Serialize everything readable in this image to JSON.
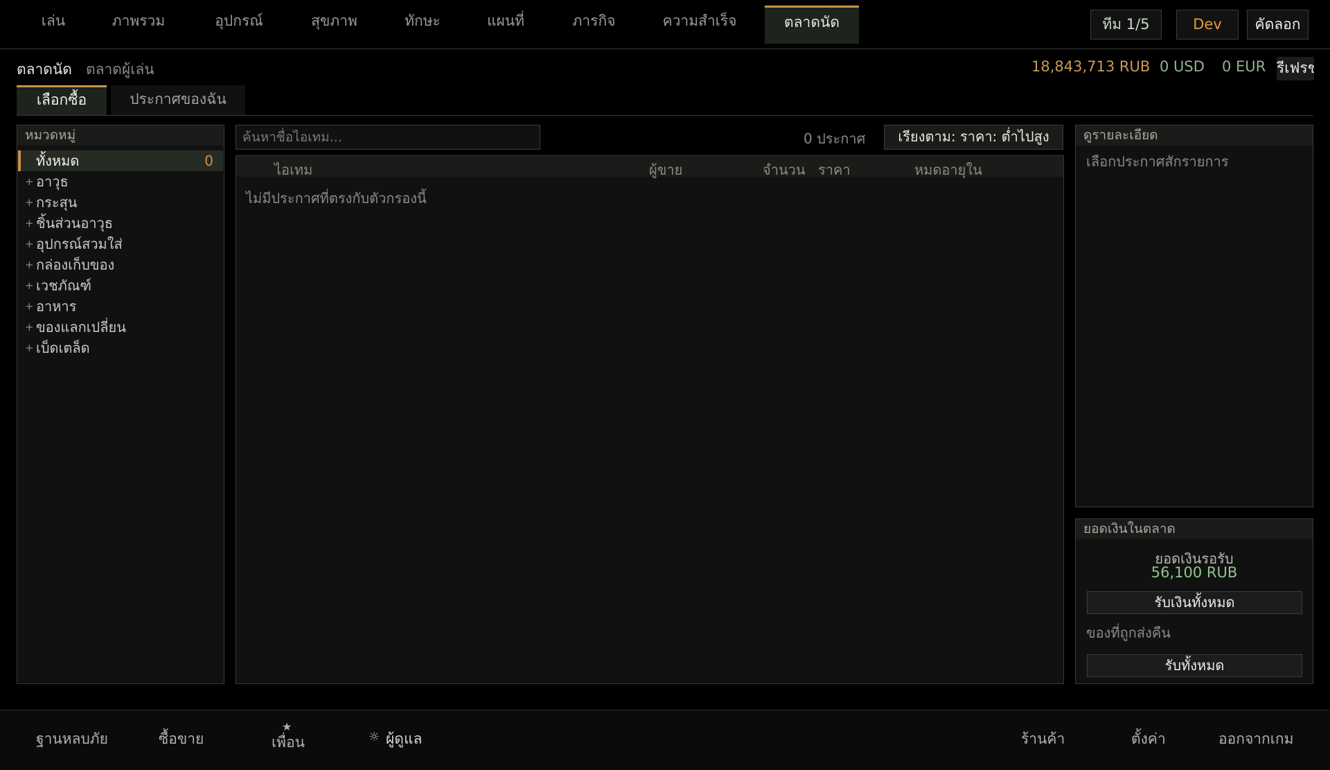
{
  "nav": {
    "tabs": [
      "เล่น",
      "ภาพรวม",
      "อุปกรณ์",
      "สุขภาพ",
      "ทักษะ",
      "แผนที่",
      "ภารกิจ",
      "ความสำเร็จ",
      "ตลาดนัด"
    ],
    "active": "ตลาดนัด",
    "team_label": "ทีม 1/5",
    "dev_label": "Dev",
    "copy_label": "คัดลอก"
  },
  "subnav": {
    "market": "ตลาดนัด",
    "player_market": "ตลาดผู้เล่น"
  },
  "currency": {
    "rub": "18,843,713 RUB",
    "usd": "0 USD",
    "eur": "0 EUR",
    "refresh_label": "รีเฟรช"
  },
  "mode_tabs": {
    "buy": "เลือกซื้อ",
    "my_listings": "ประกาศของฉัน"
  },
  "categories": {
    "title": "หมวดหมู่",
    "selected": "ทั้งหมด",
    "selected_badge": "0",
    "items": [
      "อาวุธ",
      "กระสุน",
      "ชิ้นส่วนอาวุธ",
      "อุปกรณ์สวมใส่",
      "กล่องเก็บของ",
      "เวชภัณฑ์",
      "อาหาร",
      "ของแลกเปลี่ยน",
      "เบ็ดเตล็ด"
    ],
    "plus_glyph": "+"
  },
  "search": {
    "placeholder": "ค้นหาชื่อไอเทม...",
    "value": ""
  },
  "listing_count": "0 ประกาศ",
  "sort_label": "เรียงตาม: ราคา: ต่ำไปสูง",
  "table": {
    "columns": [
      "ไอเทม",
      "ผู้ขาย",
      "จำนวน",
      "ราคา",
      "หมดอายุใน"
    ],
    "empty_message": "ไม่มีประกาศที่ตรงกับตัวกรองนี้"
  },
  "details": {
    "title": "ดูรายละเอียด",
    "hint": "เลือกประกาศสักรายการ"
  },
  "wallet": {
    "title": "ยอดเงินในตลาด",
    "pending_label": "ยอดเงินรอรับ",
    "pending_value": "56,100 RUB",
    "claim_money_label": "รับเงินทั้งหมด",
    "returned_label": "ของที่ถูกส่งคืน",
    "claim_all_label": "รับทั้งหมด"
  },
  "bottom": {
    "hideout": "ฐานหลบภัย",
    "trade": "ซื้อขาย",
    "friends": "เพื่อน",
    "friends_icon": "★",
    "admin": "ผู้ดูแล",
    "admin_icon": "☼",
    "shop": "ร้านค้า",
    "settings": "ตั้งค่า",
    "exit": "ออกจากเกม"
  },
  "colors": {
    "accent": "#c7924a",
    "rub": "#c89a55",
    "usd_eur": "#8fb38f",
    "pending": "#8fc48f",
    "dev": "#e39a3f"
  }
}
